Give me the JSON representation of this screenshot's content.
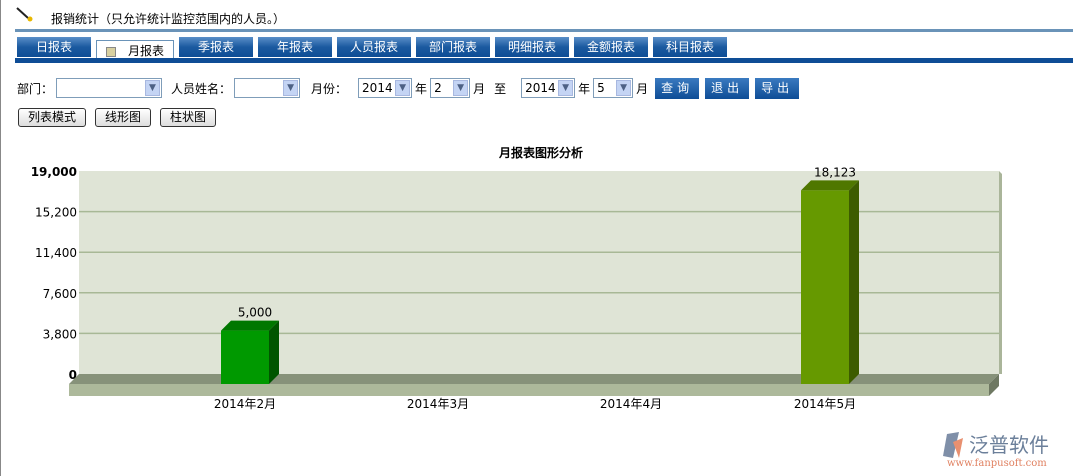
{
  "header": {
    "title": "报销统计（只允许统计监控范围内的人员。）",
    "icon": "pen-icon"
  },
  "tabs": [
    "日报表",
    "月报表",
    "季报表",
    "年报表",
    "人员报表",
    "部门报表",
    "明细报表",
    "金额报表",
    "科目报表"
  ],
  "active_tab": 1,
  "filters": {
    "dept_label": "部门：",
    "dept_value": "",
    "person_label": "人员姓名：",
    "person_value": "",
    "month_label": "月份：",
    "from_year": "2014",
    "year_unit": "年",
    "from_month": "2",
    "month_unit": "月",
    "to_label": "至",
    "to_year": "2014",
    "to_month": "5",
    "query": "查询",
    "exit": "退出",
    "export": "导出"
  },
  "modes": [
    "列表模式",
    "线形图",
    "柱状图"
  ],
  "chart_data": {
    "type": "bar",
    "title": "月报表图形分析",
    "categories": [
      "2014年2月",
      "2014年3月",
      "2014年4月",
      "2014年5月"
    ],
    "values": [
      5000,
      0,
      0,
      18123
    ],
    "value_labels": [
      "5,000",
      "",
      "",
      "18,123"
    ],
    "ylim": [
      0,
      19000
    ],
    "yticks": [
      0,
      3800,
      7600,
      11400,
      15200,
      19000
    ],
    "ytick_labels": [
      "0",
      "3,800",
      "7,600",
      "11,400",
      "15,200",
      "19,000"
    ],
    "colors": [
      "#009900",
      "",
      "",
      "#669900"
    ],
    "grid": true
  },
  "logo": {
    "name": "泛普软件",
    "url": "www.fanpusoft.com"
  }
}
